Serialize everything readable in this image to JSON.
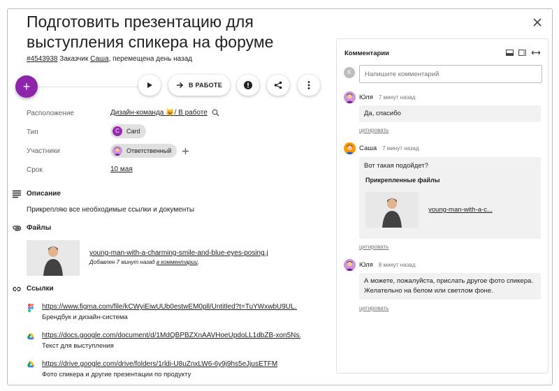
{
  "task": {
    "title": "Подготовить презентацию для выступления спикера на форуме",
    "id": "#4543938",
    "meta_customer_prefix": " Заказчик ",
    "customer": "Саша",
    "meta_suffix": ", перемещена день назад"
  },
  "actions": {
    "add_label": "+",
    "status_label": "В РАБОТЕ"
  },
  "fields": {
    "location_label": "Расположение",
    "location_value": "Дизайн-команда 😺/ В работе",
    "type_label": "Тип",
    "type_chip_letter": "C",
    "type_value": "Card",
    "participants_label": "Участники",
    "participant_value": "Ответственный",
    "deadline_label": "Срок",
    "deadline_value": "10 мая"
  },
  "description": {
    "title": "Описание",
    "text": "Прикрепляю все необходимые ссылки и документы"
  },
  "files": {
    "title": "Файлы",
    "items": [
      {
        "name": "young-man-with-a-charming-smile-and-blue-eyes-posing.j...",
        "added_prefix": "Добавлен 7 минут назад ",
        "added_link": "в комментарии",
        "added_suffix": ","
      }
    ]
  },
  "links": {
    "title": "Ссылки",
    "items": [
      {
        "icon": "figma-icon",
        "url": "https://www.figma.com/file/kCWyiEiwUUb0estwEM0pll/Untitled?t=TuYWxwbU9UL...",
        "desc": "Брендбук и дизайн-система"
      },
      {
        "icon": "google-drive-icon",
        "url": "https://docs.google.com/document/d/1MdQBPBZXnAAVHoeUpdoLL1dbZB-xon5Ns...",
        "desc": "Текст для выступления"
      },
      {
        "icon": "google-drive-icon",
        "url": "https://drive.google.com/drive/folders/1rldi-U8uZnxLW6-6y9j9hs5eJjusETFM",
        "desc": "Фото спикера и другие презентации по продукту"
      }
    ]
  },
  "comments": {
    "title": "Комментарии",
    "input_avatar": "K",
    "input_placeholder": "Напишите комментарий",
    "quote_label": "цитировать",
    "items": [
      {
        "author": "Юля",
        "time": "7 минут назад",
        "text": "Да, спасибо"
      },
      {
        "author": "Саша",
        "time": "7 минут назад",
        "text": "Вот такая подойдет?",
        "attachments_title": "Прикрепленные файлы",
        "attachment_name": "young-man-with-a-c..."
      },
      {
        "author": "Юля",
        "time": "8 минут назад",
        "text": "А можете, пожалуйста, прислать другое фото спикера. Желательно на белом или светлом фоне."
      }
    ]
  },
  "colors": {
    "accent": "#8e24aa",
    "chip_bg": "#e0e0e0",
    "bubble_bg": "#f1f1f1"
  }
}
